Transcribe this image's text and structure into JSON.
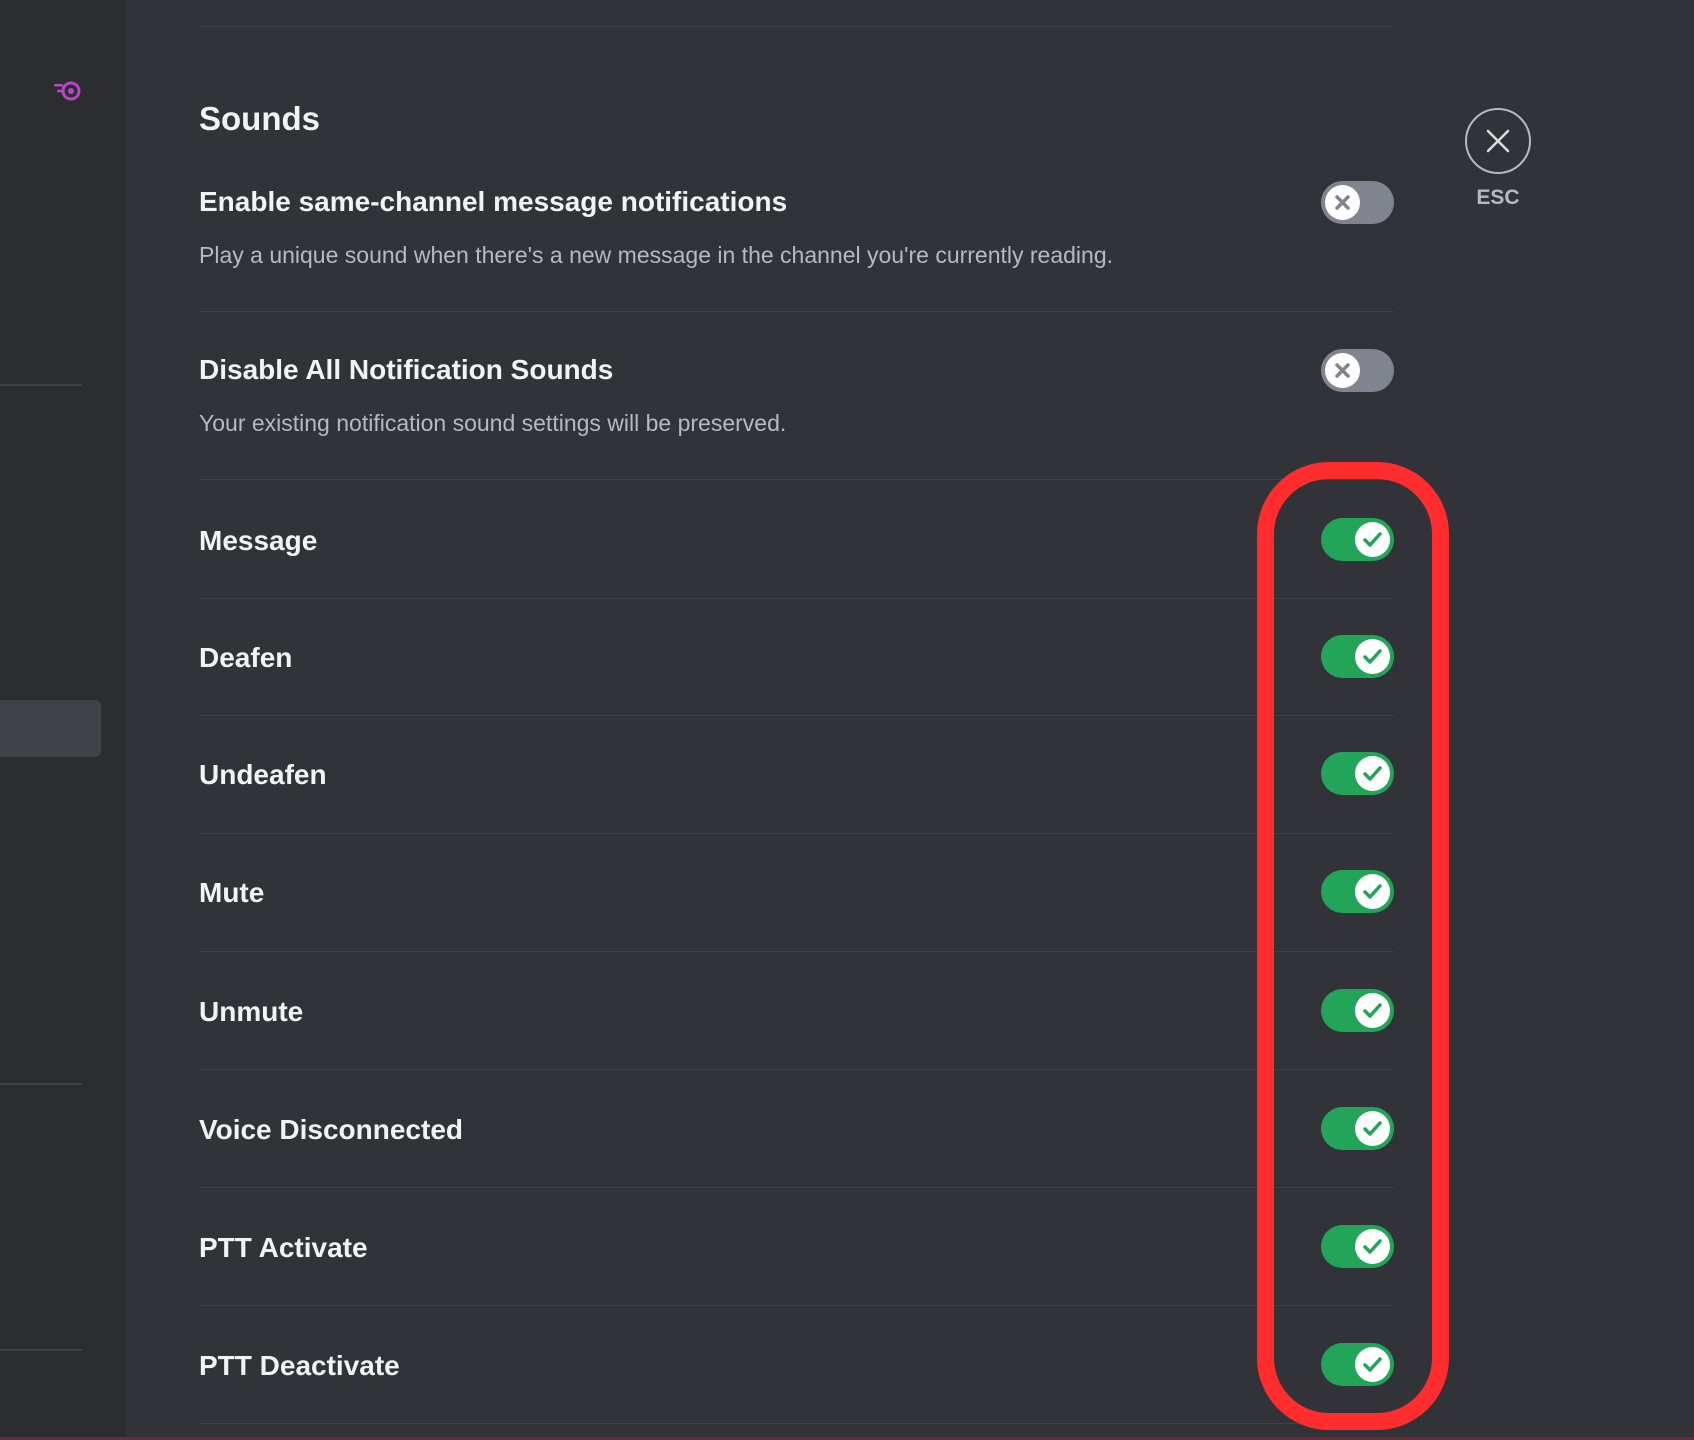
{
  "section": {
    "title": "Sounds"
  },
  "settings": {
    "same_channel": {
      "label": "Enable same-channel message notifications",
      "description": "Play a unique sound when there's a new message in the channel you're currently reading.",
      "enabled": false
    },
    "disable_all": {
      "label": "Disable All Notification Sounds",
      "description": "Your existing notification sound settings will be preserved.",
      "enabled": false
    }
  },
  "sounds": [
    {
      "label": "Message",
      "enabled": true
    },
    {
      "label": "Deafen",
      "enabled": true
    },
    {
      "label": "Undeafen",
      "enabled": true
    },
    {
      "label": "Mute",
      "enabled": true
    },
    {
      "label": "Unmute",
      "enabled": true
    },
    {
      "label": "Voice Disconnected",
      "enabled": true
    },
    {
      "label": "PTT Activate",
      "enabled": true
    },
    {
      "label": "PTT Deactivate",
      "enabled": true
    }
  ],
  "close": {
    "label": "ESC",
    "icon": "close-icon"
  },
  "colors": {
    "toggle_on": "#23a559",
    "toggle_off": "#80848e",
    "highlight": "#ff2d2d",
    "background": "#313338"
  }
}
